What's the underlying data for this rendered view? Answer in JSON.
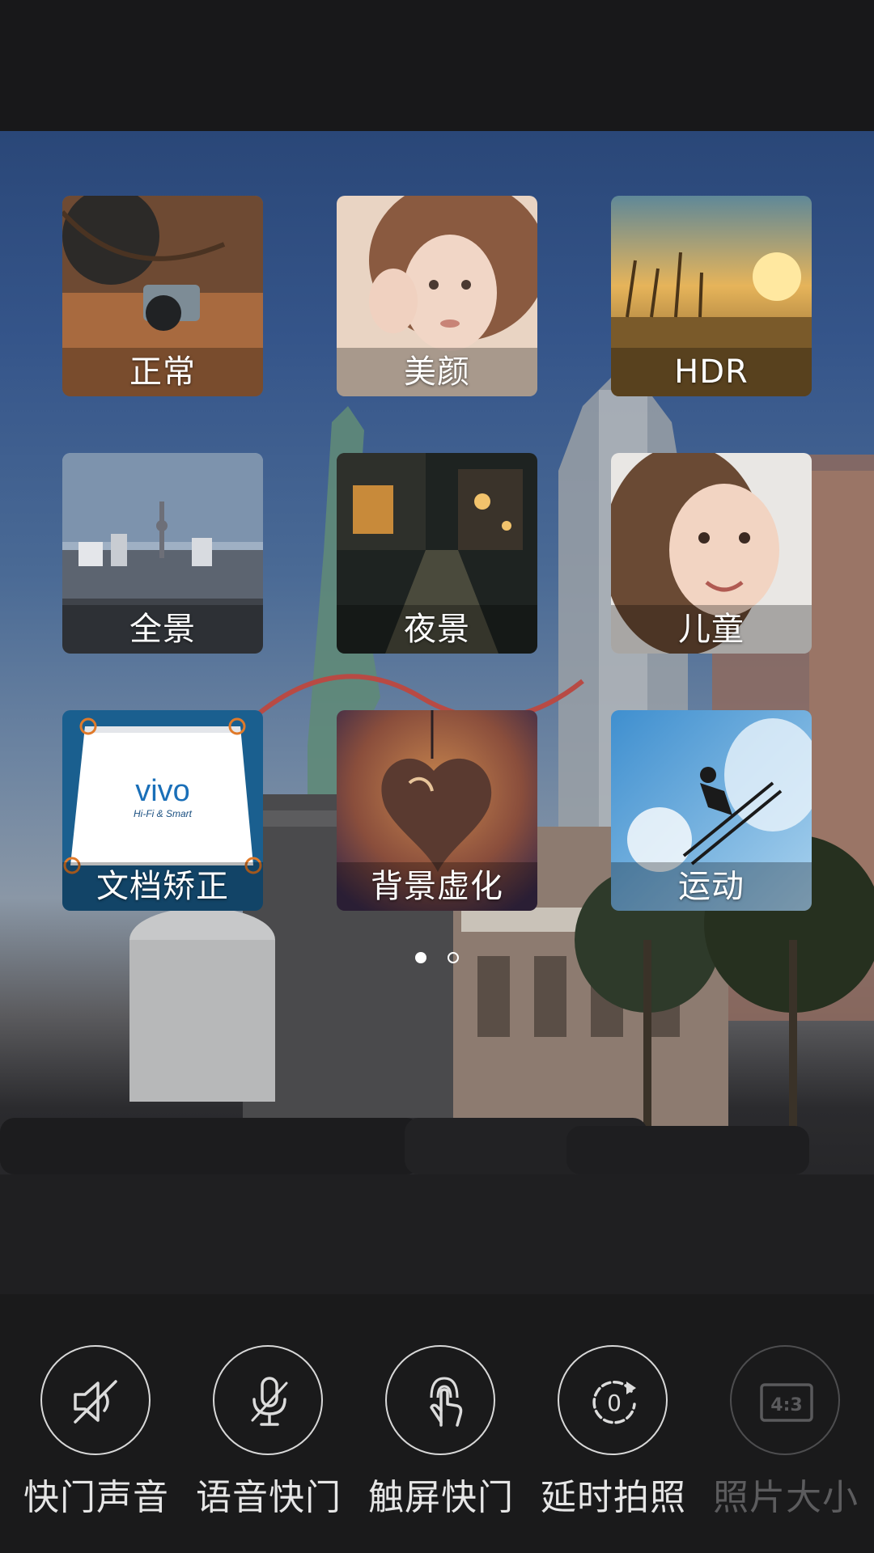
{
  "modes": [
    {
      "label": "正常"
    },
    {
      "label": "美颜"
    },
    {
      "label": "HDR"
    },
    {
      "label": "全景"
    },
    {
      "label": "夜景"
    },
    {
      "label": "儿童"
    },
    {
      "label": "文档矫正",
      "logo_text": "vivo",
      "logo_tagline": "Hi-Fi & Smart"
    },
    {
      "label": "背景虚化"
    },
    {
      "label": "运动"
    }
  ],
  "pager": {
    "pages": 2,
    "current": 1
  },
  "settings": [
    {
      "label": "快门声音",
      "icon": "speaker-muted-icon",
      "enabled": true
    },
    {
      "label": "语音快门",
      "icon": "microphone-icon",
      "enabled": true
    },
    {
      "label": "触屏快门",
      "icon": "touch-hand-icon",
      "enabled": true
    },
    {
      "label": "延时拍照",
      "icon": "timer-icon",
      "enabled": true,
      "icon_text": "0"
    },
    {
      "label": "照片大小",
      "icon": "aspect-ratio-icon",
      "enabled": false,
      "icon_text": "4:3"
    }
  ]
}
